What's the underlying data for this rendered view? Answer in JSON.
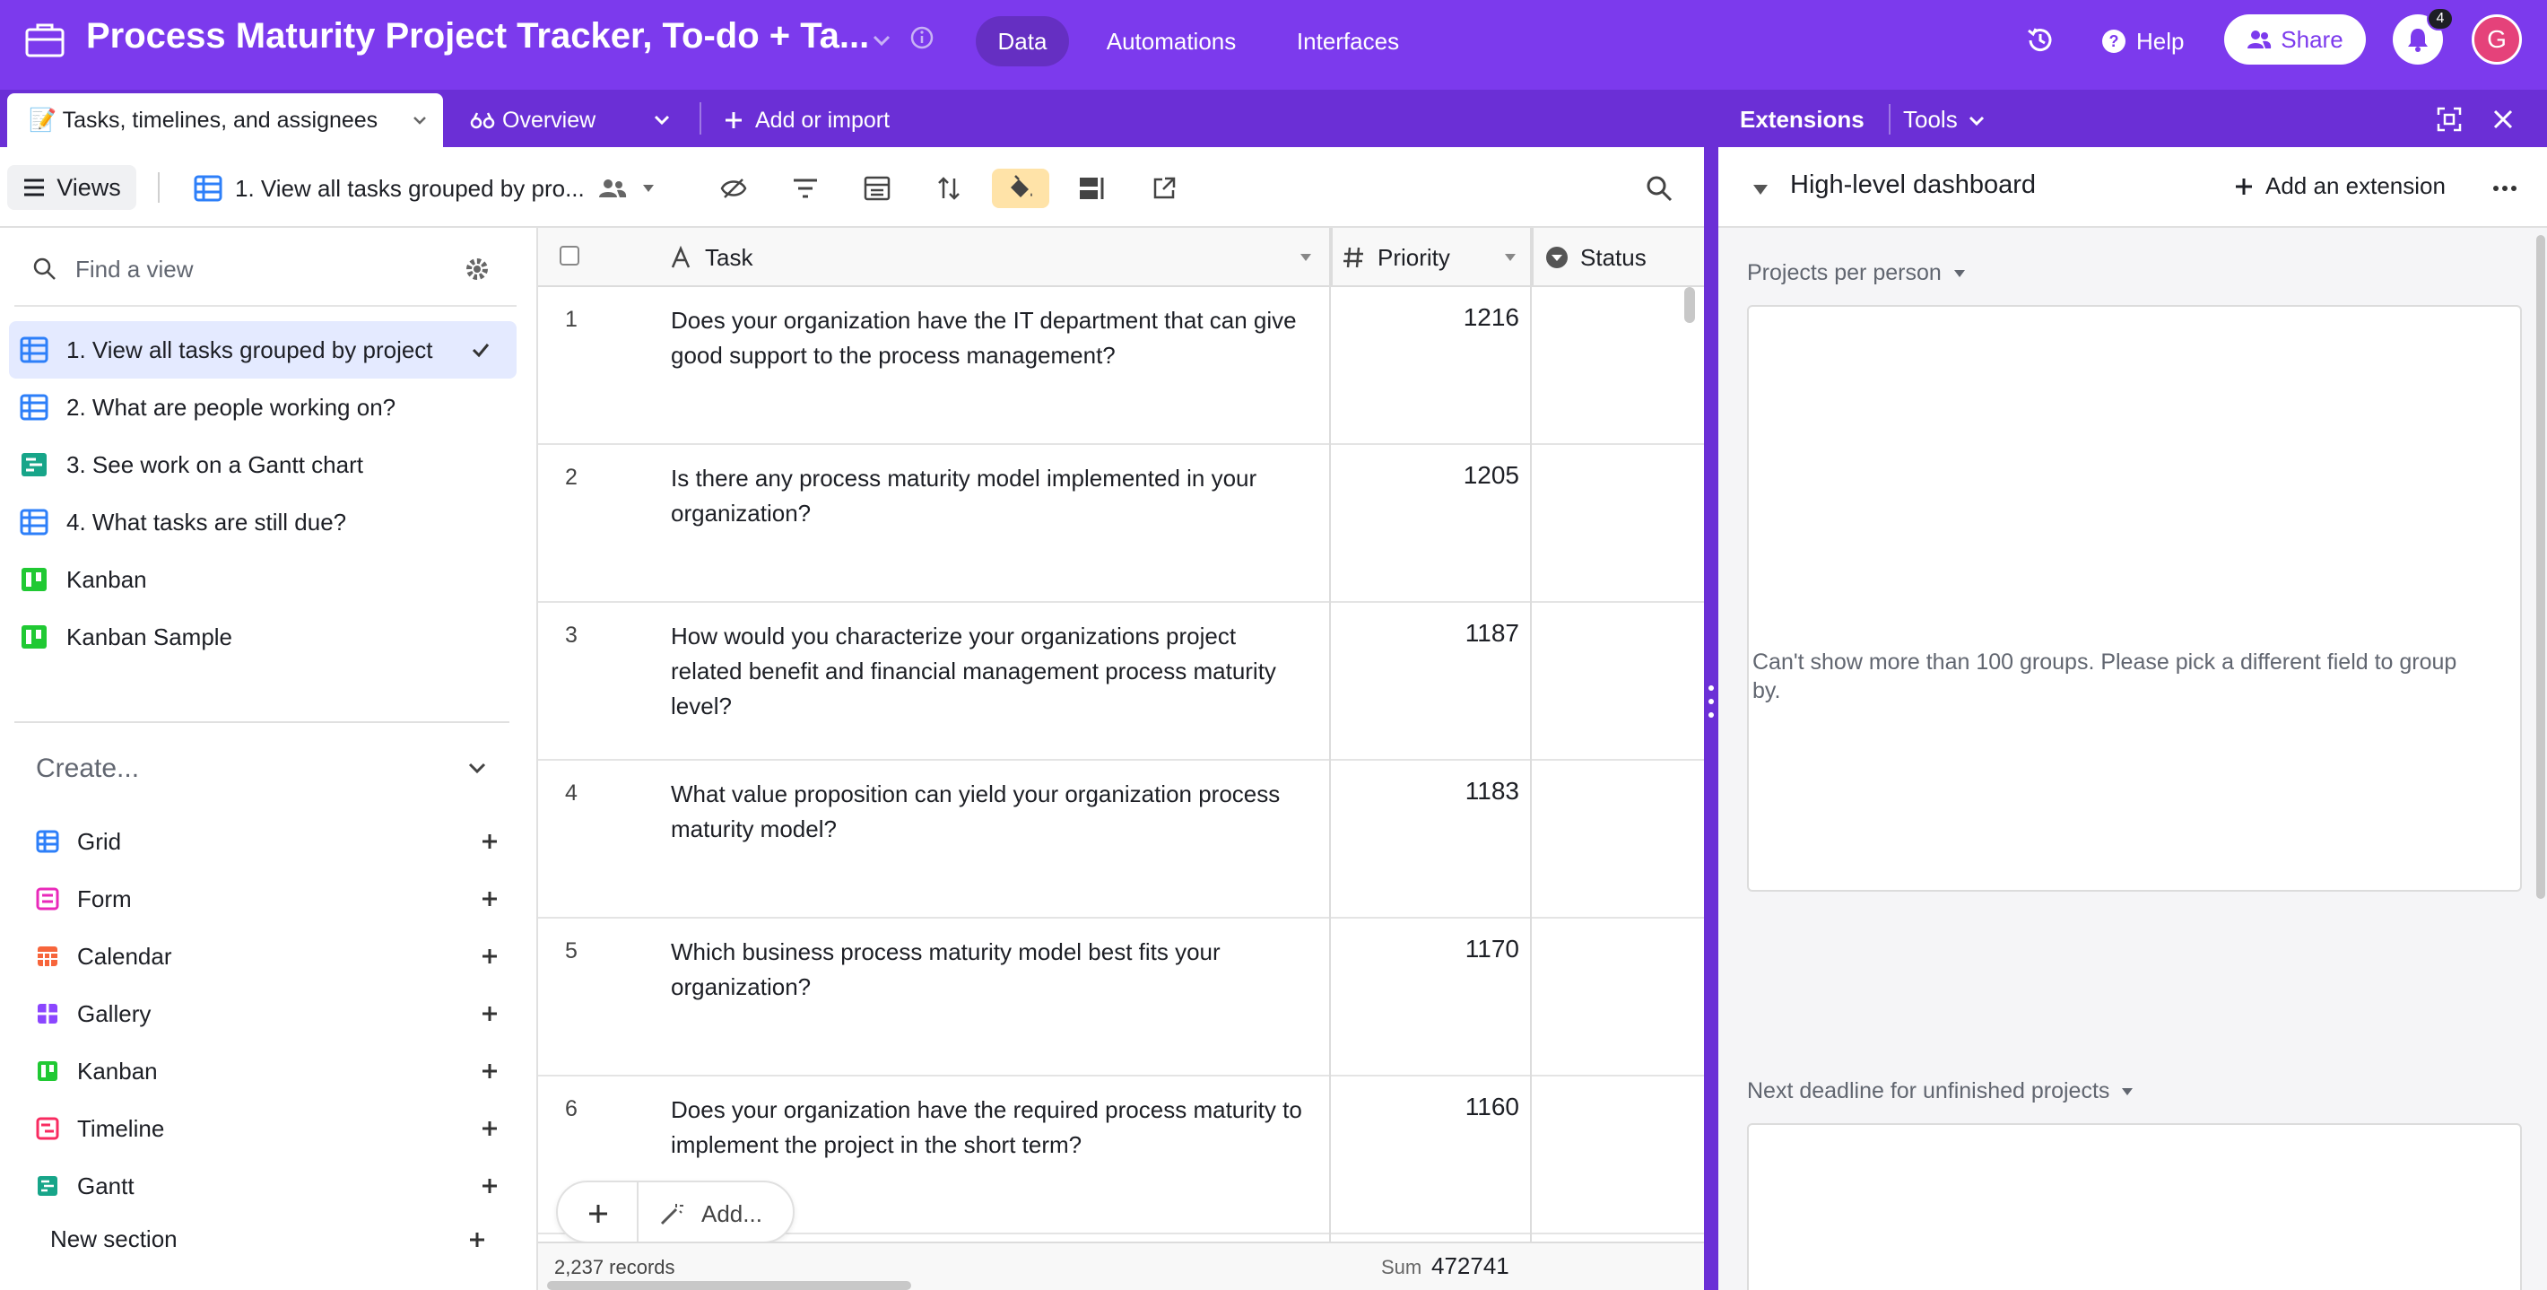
{
  "app": {
    "title": "Process Maturity Project Tracker, To-do + Ta...",
    "nav": [
      "Data",
      "Automations",
      "Interfaces"
    ],
    "help_label": "Help",
    "share_label": "Share",
    "notification_count": "4",
    "avatar_initial": "G",
    "accent": "#7c3aed"
  },
  "tabs": {
    "active": "📝 Tasks, timelines, and assignees",
    "overview": "Overview",
    "add": "Add or import"
  },
  "toolbar": {
    "views_label": "Views",
    "view_name": "1. View all tasks grouped by pro..."
  },
  "sidebar": {
    "find_placeholder": "Find a view",
    "views": [
      {
        "label": "1. View all tasks grouped by project",
        "icon": "grid-icon",
        "selected": true
      },
      {
        "label": "2. What are people working on?",
        "icon": "grid-icon"
      },
      {
        "label": "3. See work on a Gantt chart",
        "icon": "gantt-icon"
      },
      {
        "label": "4. What tasks are still due?",
        "icon": "grid-icon"
      },
      {
        "label": "Kanban",
        "icon": "kanban-icon"
      },
      {
        "label": "Kanban Sample",
        "icon": "kanban-icon"
      }
    ],
    "create_label": "Create...",
    "create_items": [
      {
        "label": "Grid",
        "color": "#2d7ff9"
      },
      {
        "label": "Form",
        "color": "#e929ba"
      },
      {
        "label": "Calendar",
        "color": "#f7653b"
      },
      {
        "label": "Gallery",
        "color": "#8b46ff"
      },
      {
        "label": "Kanban",
        "color": "#20c933"
      },
      {
        "label": "Timeline",
        "color": "#f82b60"
      },
      {
        "label": "Gantt",
        "color": "#17a589"
      }
    ],
    "new_section": "New section"
  },
  "grid": {
    "columns": [
      "Task",
      "Priority",
      "Status"
    ],
    "rows": [
      {
        "num": "1",
        "task": "Does your organization have the IT department that can give good support to the process management?",
        "priority": "1216"
      },
      {
        "num": "2",
        "task": "Is there any process maturity model implemented in your organization?",
        "priority": "1205"
      },
      {
        "num": "3",
        "task": "How would you characterize your organizations project related benefit and financial management process maturity level?",
        "priority": "1187"
      },
      {
        "num": "4",
        "task": "What value proposition can yield your organization process maturity model?",
        "priority": "1183"
      },
      {
        "num": "5",
        "task": "Which business process maturity model best fits your organization?",
        "priority": "1170"
      },
      {
        "num": "6",
        "task": "Does your organization have the required process maturity to implement the project in the short term?",
        "priority": "1160"
      }
    ],
    "add_label": "Add...",
    "records": "2,237 records",
    "sum_label": "Sum",
    "sum_value": "472741"
  },
  "extensions": {
    "title": "Extensions",
    "tools": "Tools",
    "dashboard": "High-level dashboard",
    "add_extension": "Add an extension",
    "widget1_label": "Projects per person",
    "widget1_message": "Can't show more than 100 groups. Please pick a different field to group by.",
    "widget2_label": "Next deadline for unfinished projects"
  }
}
